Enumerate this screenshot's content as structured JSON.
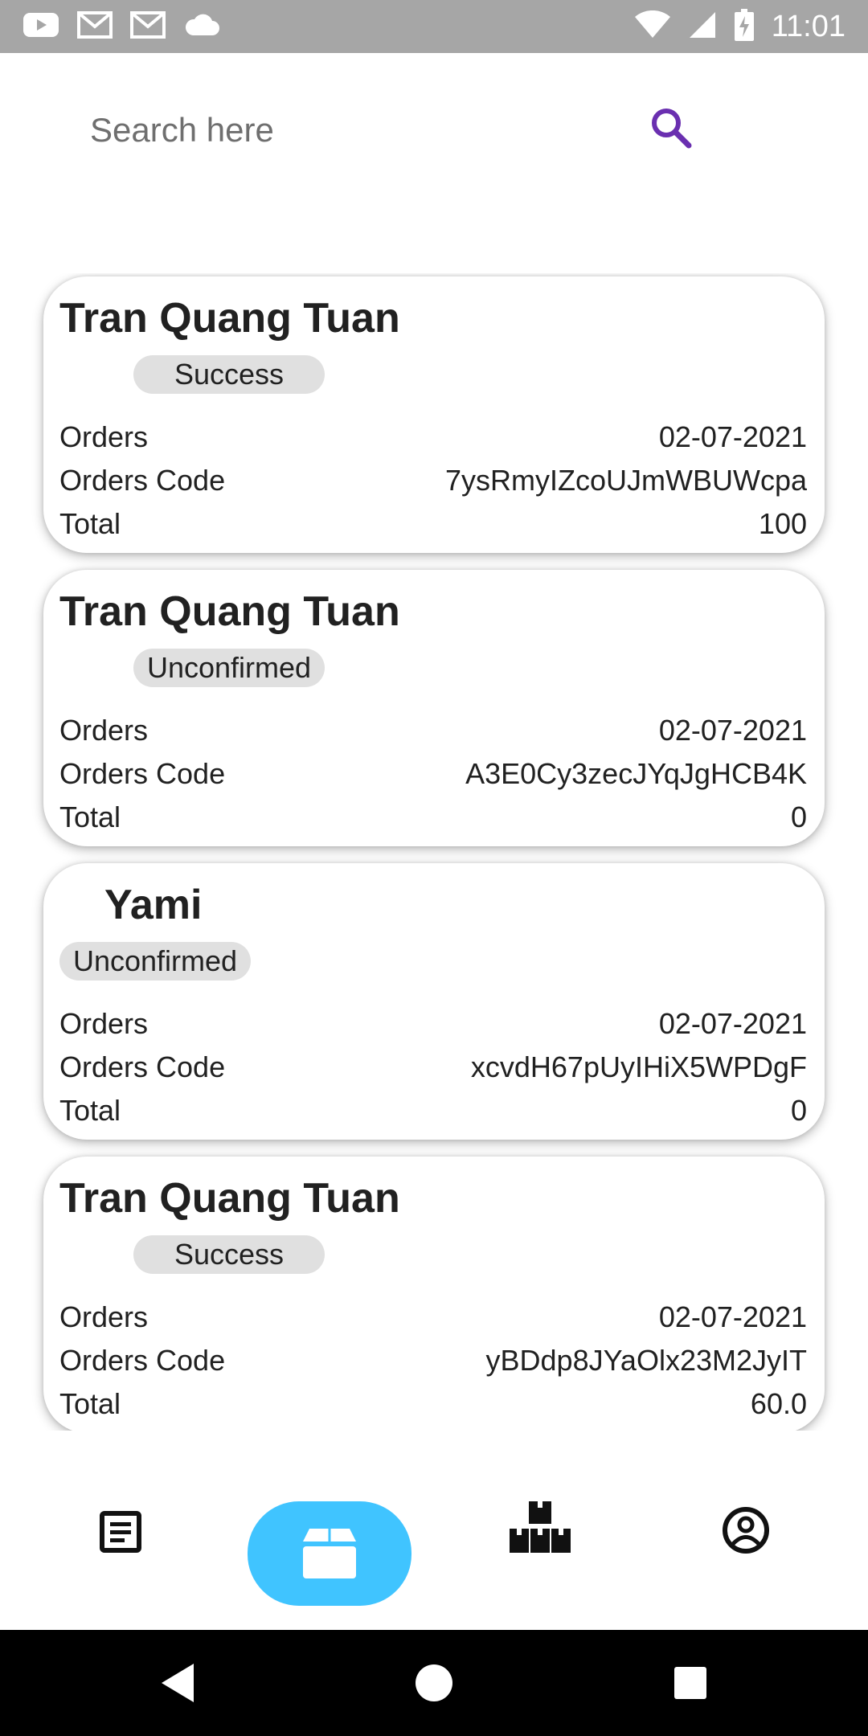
{
  "status_bar": {
    "time": "11:01",
    "left_icons": [
      "youtube-icon",
      "gmail-icon",
      "gmail-icon",
      "cloud-icon"
    ],
    "right_icons": [
      "wifi-icon",
      "cell-signal-icon",
      "battery-charging-icon"
    ]
  },
  "search": {
    "placeholder": "Search here",
    "value": "",
    "icon": "search-icon",
    "icon_color": "#6a2fb0"
  },
  "orders": [
    {
      "name": "Tran Quang Tuan",
      "status": "Success",
      "rows": [
        {
          "label": "Orders",
          "value": "02-07-2021"
        },
        {
          "label": "Orders Code",
          "value": "7ysRmyIZcoUJmWBUWcpa"
        },
        {
          "label": "Total",
          "value": "100"
        }
      ]
    },
    {
      "name": "Tran Quang Tuan",
      "status": "Unconfirmed",
      "rows": [
        {
          "label": "Orders",
          "value": "02-07-2021"
        },
        {
          "label": "Orders Code",
          "value": "A3E0Cy3zecJYqJgHCB4K"
        },
        {
          "label": "Total",
          "value": "0"
        }
      ]
    },
    {
      "name": "Yami",
      "status": "Unconfirmed",
      "rows": [
        {
          "label": "Orders",
          "value": "02-07-2021"
        },
        {
          "label": "Orders Code",
          "value": "xcvdH67pUyIHiX5WPDgF"
        },
        {
          "label": "Total",
          "value": "0"
        }
      ]
    },
    {
      "name": "Tran Quang Tuan",
      "status": "Success",
      "rows": [
        {
          "label": "Orders",
          "value": "02-07-2021"
        },
        {
          "label": "Orders Code",
          "value": "yBDdp8JYaOlx23M2JyIT"
        },
        {
          "label": "Total",
          "value": "60.0"
        }
      ]
    }
  ],
  "bottom_nav": {
    "active_color": "#40c4ff",
    "items": [
      {
        "icon": "list-icon",
        "active": false
      },
      {
        "icon": "box-icon",
        "active": true
      },
      {
        "icon": "stock-boxes-icon",
        "active": false
      },
      {
        "icon": "account-icon",
        "active": false
      }
    ]
  },
  "system_nav": [
    "back-icon",
    "home-icon",
    "recents-icon"
  ]
}
